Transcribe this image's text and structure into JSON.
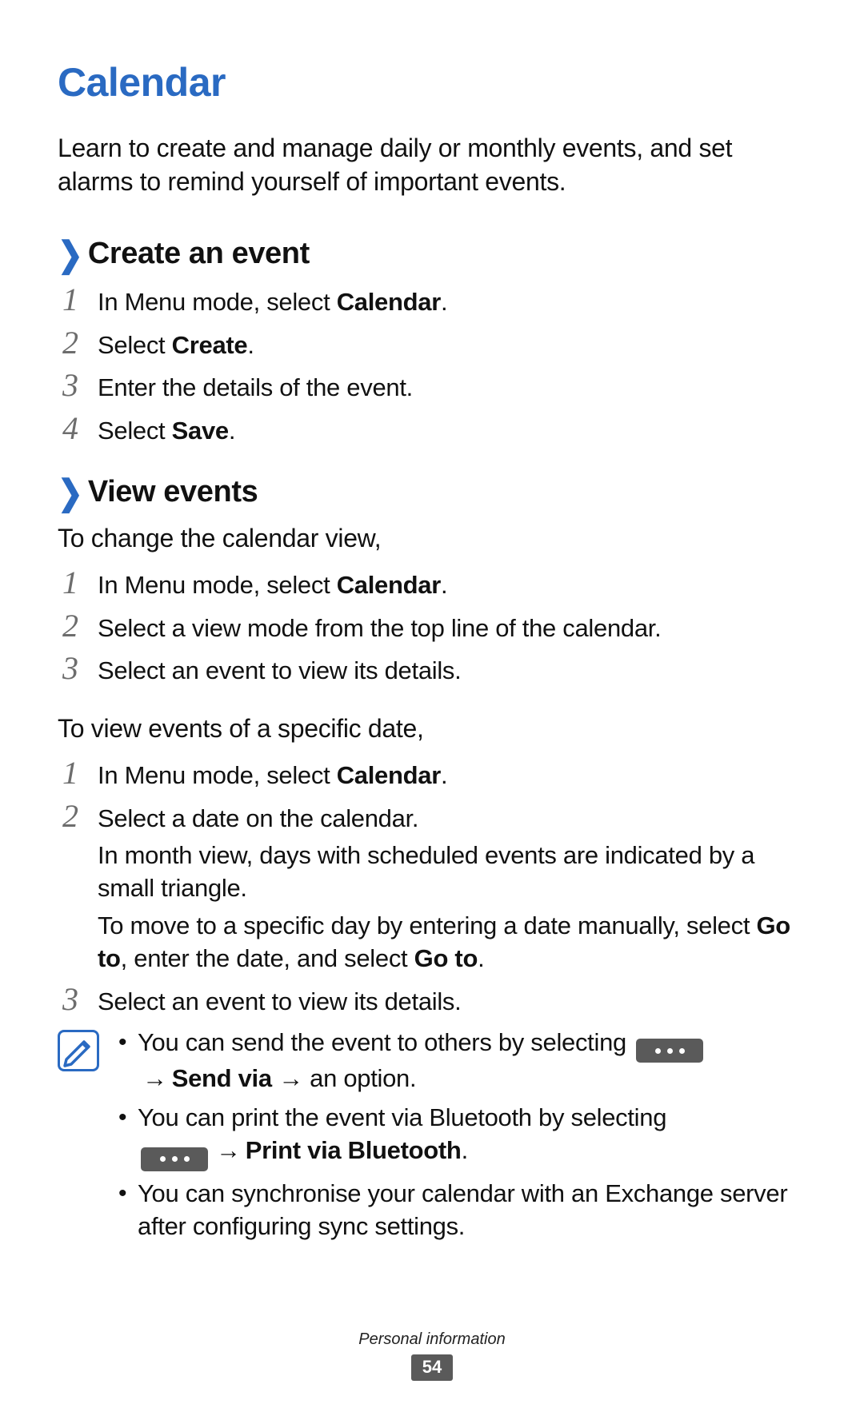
{
  "title": "Calendar",
  "intro": "Learn to create and manage daily or monthly events, and set alarms to remind yourself of important events.",
  "sections": {
    "create": {
      "heading": "Create an event",
      "steps": [
        {
          "pre": "In Menu mode, select ",
          "bold": "Calendar",
          "post": "."
        },
        {
          "pre": "Select ",
          "bold": "Create",
          "post": "."
        },
        {
          "pre": "Enter the details of the event.",
          "bold": "",
          "post": ""
        },
        {
          "pre": "Select ",
          "bold": "Save",
          "post": "."
        }
      ]
    },
    "view": {
      "heading": "View events",
      "lead1": "To change the calendar view,",
      "steps1": [
        {
          "pre": "In Menu mode, select ",
          "bold": "Calendar",
          "post": "."
        },
        {
          "pre": "Select a view mode from the top line of the calendar.",
          "bold": "",
          "post": ""
        },
        {
          "pre": "Select an event to view its details.",
          "bold": "",
          "post": ""
        }
      ],
      "lead2": "To view events of a specific date,",
      "steps2": [
        {
          "line": {
            "pre": "In Menu mode, select ",
            "bold": "Calendar",
            "post": "."
          }
        },
        {
          "line": {
            "pre": "Select a date on the calendar.",
            "bold": "",
            "post": ""
          },
          "extra1": "In month view, days with scheduled events are indicated by a small triangle.",
          "extra2a": "To move to a specific day by entering a date manually, select ",
          "extra2b": "Go to",
          "extra2c": ", enter the date, and select ",
          "extra2d": "Go to",
          "extra2e": "."
        },
        {
          "line": {
            "pre": "Select an event to view its details.",
            "bold": "",
            "post": ""
          }
        }
      ]
    }
  },
  "notes": {
    "n1a": "You can send the event to others by selecting ",
    "n1b": " → ",
    "n1c": "Send via",
    "n1d": " → an option.",
    "n2a": "You can print the event via Bluetooth by selecting ",
    "n2b": " → ",
    "n2c": "Print via Bluetooth",
    "n2d": ".",
    "n3": "You can synchronise your calendar with an Exchange server after configuring sync settings."
  },
  "footer": {
    "section": "Personal information",
    "page": "54"
  },
  "glyphs": {
    "chevron": "❯",
    "arrow": "→"
  }
}
